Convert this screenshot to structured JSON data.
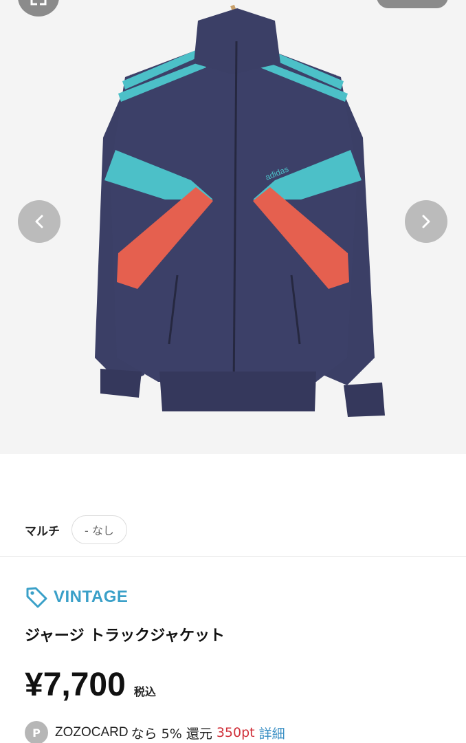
{
  "gallery": {
    "image_alt": "adidas track jacket navy with turquoise and orange panels",
    "logo_text": "adidas"
  },
  "product": {
    "color_name": "マルチ",
    "stock_status": "- なし",
    "brand": "VINTAGE",
    "title": "ジャージ トラックジャケット",
    "price": "¥7,700",
    "tax_label": "税込"
  },
  "points": {
    "badge": "P",
    "card": "ZOZOCARD",
    "text": "なら 5% 還元",
    "value": "350pt",
    "detail_link": "詳細"
  },
  "colors": {
    "navy": "#3b3f66",
    "turquoise": "#4cc0c8",
    "orange": "#e5604f",
    "brand_blue": "#3aa0c8",
    "points_red": "#d0303a"
  }
}
